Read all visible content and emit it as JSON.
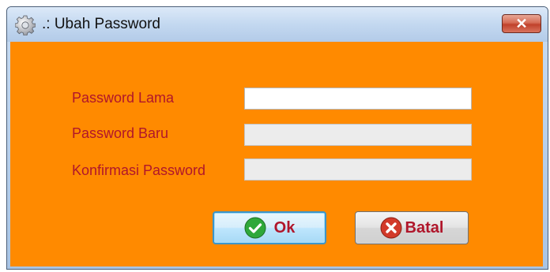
{
  "window": {
    "title": ".: Ubah Password",
    "title_icon": "gear-icon",
    "close_icon": "close-icon",
    "close_label": "✕"
  },
  "form": {
    "old_password_label": "Password Lama",
    "old_password_value": "",
    "new_password_label": "Password Baru",
    "new_password_value": "",
    "confirm_password_label": "Konfirmasi Password",
    "confirm_password_value": ""
  },
  "buttons": {
    "ok_label": "Ok",
    "ok_icon": "check-icon",
    "cancel_label": "Batal",
    "cancel_icon": "cancel-x-icon"
  },
  "colors": {
    "client_background": "#ff8a00",
    "label_text": "#b0162b",
    "ok_icon": "#2fa83a",
    "cancel_icon": "#d23a2a"
  }
}
